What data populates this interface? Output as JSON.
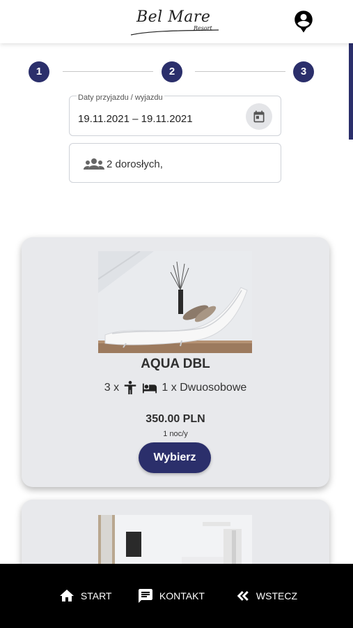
{
  "header": {
    "logo_text": "Bel Mare",
    "logo_sub": "Resort",
    "account_icon": "account-circle-icon"
  },
  "stepper": {
    "steps": [
      "1",
      "2",
      "3"
    ],
    "active_color": "#2b2f6b"
  },
  "booking_form": {
    "dates_label": "Daty przyjazdu / wyjazdu",
    "dates_value": "19.11.2021 – 19.11.2021",
    "calendar_icon": "calendar-icon",
    "guests_icon": "people-icon",
    "guests_value": "2 dorosłych,"
  },
  "rooms": [
    {
      "name": "AQUA DBL",
      "capacity": "3 x",
      "beds": "1 x Dwuosobowe",
      "price": "350.00 PLN",
      "per_night": "1 noc/y",
      "button_label": "Wybierz"
    },
    {
      "name": "",
      "capacity": "",
      "beds": "",
      "price": "",
      "per_night": "",
      "button_label": ""
    }
  ],
  "bottom_nav": {
    "items": [
      {
        "label": "START",
        "icon": "home-icon"
      },
      {
        "label": "KONTAKT",
        "icon": "message-icon"
      },
      {
        "label": "WSTECZ",
        "icon": "double-chevron-left-icon"
      }
    ]
  },
  "colors": {
    "brand": "#2b2f6b",
    "card_bg": "#e8e9ec",
    "nav_bg": "#000000"
  }
}
